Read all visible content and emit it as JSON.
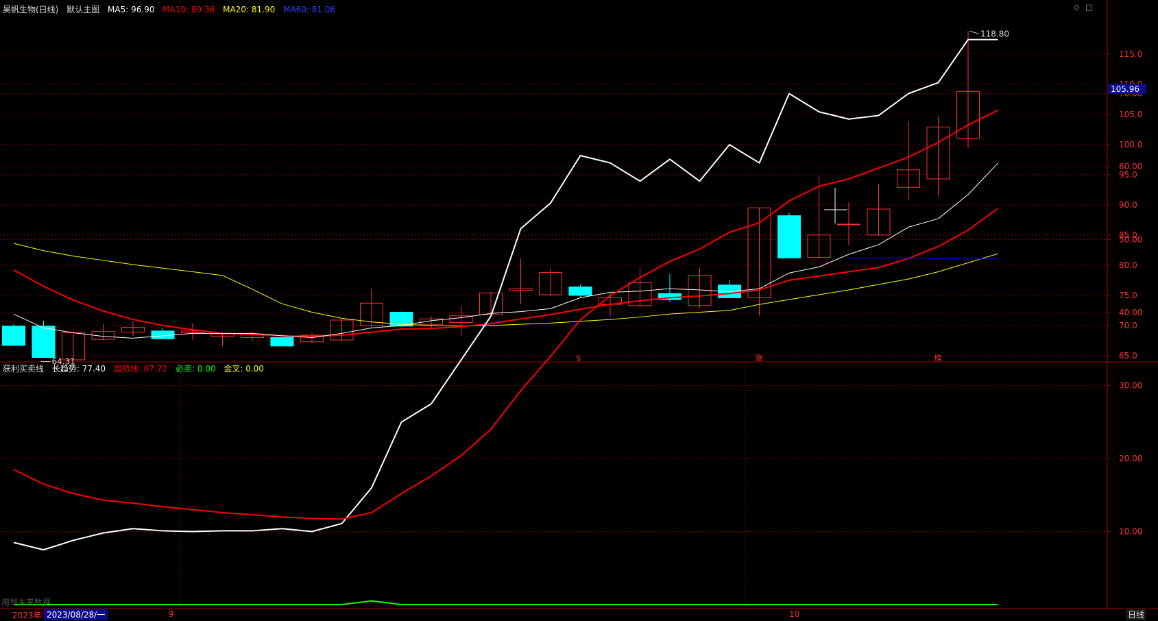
{
  "main_header": {
    "stock": "昊帆生物(日线)",
    "template": "默认主图",
    "ma5": "MA5: 96.90",
    "ma10": "MA10: 89.36",
    "ma20": "MA20: 81.90",
    "ma60": "MA60: 81.06"
  },
  "sub_header": {
    "indicator": "获利买卖线",
    "long_trend": "长趋势: 77.40",
    "trend_line": "趋势线: 67.72",
    "must_sell": "必卖: 0.00",
    "golden_cross": "金叉: 0.00"
  },
  "bottom": {
    "year": "2023年",
    "date": "2023/08/28/一",
    "m9": "9",
    "m10": "10",
    "period": "日线",
    "watermark": "用到未来数据"
  },
  "colors": {
    "up": "#ff3232",
    "down": "#00ffff",
    "ma5": "#ffffff",
    "ma10": "#ff0000",
    "ma20": "#ffff00",
    "ma60": "#0000ff",
    "long": "#ffffff",
    "trend": "#ff0000",
    "must": "#00ff00",
    "grid": "#7a0000"
  },
  "chart_data": [
    {
      "type": "candlestick",
      "yticks": [
        65.0,
        70.0,
        75.0,
        80.0,
        85.0,
        90.0,
        95.0,
        100.0,
        105.0,
        110.0,
        115.0
      ],
      "ylim": [
        63.5,
        120.0
      ],
      "high_label": "118.80",
      "low_label": "64.31",
      "current_label": "105.96",
      "markers": [
        {
          "index": 19,
          "text": "$"
        },
        {
          "index": 25,
          "text": "涨"
        },
        {
          "index": 31,
          "text": "榜"
        }
      ],
      "candles": [
        {
          "o": 69.9,
          "h": 70.2,
          "l": 66.7,
          "c": 66.7
        },
        {
          "o": 69.9,
          "h": 70.8,
          "l": 64.7,
          "c": 64.7
        },
        {
          "o": 64.31,
          "h": 69.0,
          "l": 64.31,
          "c": 68.8
        },
        {
          "o": 67.7,
          "h": 70.3,
          "l": 67.5,
          "c": 69.0
        },
        {
          "o": 68.9,
          "h": 70.7,
          "l": 68.3,
          "c": 69.7
        },
        {
          "o": 69.1,
          "h": 69.6,
          "l": 67.7,
          "c": 67.8
        },
        {
          "o": 68.8,
          "h": 70.4,
          "l": 67.6,
          "c": 69.1
        },
        {
          "o": 68.2,
          "h": 68.7,
          "l": 66.6,
          "c": 68.6
        },
        {
          "o": 68.0,
          "h": 69.0,
          "l": 67.4,
          "c": 68.6
        },
        {
          "o": 68.0,
          "h": 68.1,
          "l": 66.6,
          "c": 66.6
        },
        {
          "o": 67.3,
          "h": 68.8,
          "l": 67.1,
          "c": 68.4
        },
        {
          "o": 67.6,
          "h": 71.0,
          "l": 67.4,
          "c": 70.9
        },
        {
          "o": 70.0,
          "h": 76.2,
          "l": 69.8,
          "c": 73.7
        },
        {
          "o": 72.2,
          "h": 72.3,
          "l": 69.9,
          "c": 69.9
        },
        {
          "o": 70.2,
          "h": 71.5,
          "l": 69.6,
          "c": 71.1
        },
        {
          "o": 70.5,
          "h": 73.2,
          "l": 68.2,
          "c": 71.6
        },
        {
          "o": 71.8,
          "h": 75.6,
          "l": 71.5,
          "c": 75.4
        },
        {
          "o": 75.8,
          "h": 81.0,
          "l": 73.5,
          "c": 76.1
        },
        {
          "o": 75.1,
          "h": 79.5,
          "l": 74.9,
          "c": 78.8
        },
        {
          "o": 76.4,
          "h": 76.8,
          "l": 74.7,
          "c": 75.0
        },
        {
          "o": 73.5,
          "h": 75.3,
          "l": 71.5,
          "c": 74.6
        },
        {
          "o": 73.3,
          "h": 79.7,
          "l": 73.1,
          "c": 77.1
        },
        {
          "o": 75.3,
          "h": 78.5,
          "l": 73.9,
          "c": 74.3
        },
        {
          "o": 73.3,
          "h": 79.6,
          "l": 72.9,
          "c": 78.3
        },
        {
          "o": 76.7,
          "h": 77.5,
          "l": 74.6,
          "c": 74.6
        },
        {
          "o": 74.6,
          "h": 89.5,
          "l": 71.6,
          "c": 89.5
        },
        {
          "o": 88.2,
          "h": 88.7,
          "l": 81.2,
          "c": 81.2
        },
        {
          "o": 81.3,
          "h": 94.7,
          "l": 81.0,
          "c": 85.0
        },
        {
          "o": 86.8,
          "h": 90.4,
          "l": 83.3,
          "c": 86.8
        },
        {
          "o": 85.0,
          "h": 93.4,
          "l": 84.9,
          "c": 89.3
        },
        {
          "o": 92.9,
          "h": 103.8,
          "l": 90.8,
          "c": 95.8
        },
        {
          "o": 94.3,
          "h": 104.7,
          "l": 91.4,
          "c": 102.9
        },
        {
          "o": 101.0,
          "h": 118.8,
          "l": 99.4,
          "c": 108.8
        }
      ],
      "ma5": [
        71.9,
        69.6,
        68.8,
        68.2,
        67.9,
        68.3,
        68.7,
        68.7,
        68.7,
        68.3,
        68.0,
        68.7,
        69.6,
        70.0,
        70.8,
        71.3,
        72.0,
        72.3,
        72.8,
        74.6,
        75.5,
        75.7,
        76.1,
        75.9,
        75.6,
        76.1,
        78.7,
        79.7,
        81.8,
        83.4,
        86.3,
        87.7,
        91.7,
        96.9
      ],
      "ma10": [
        79.2,
        76.5,
        74.2,
        72.4,
        71.0,
        70.0,
        69.3,
        68.7,
        68.5,
        68.3,
        68.2,
        68.4,
        68.9,
        69.4,
        69.5,
        69.8,
        70.3,
        71.1,
        71.8,
        72.7,
        73.5,
        74.1,
        74.6,
        74.9,
        75.3,
        75.9,
        77.5,
        78.2,
        78.9,
        79.6,
        81.1,
        83.1,
        85.8,
        89.4
      ],
      "ma20": [
        83.6,
        82.4,
        81.5,
        80.8,
        80.1,
        79.5,
        78.9,
        78.3,
        76.0,
        73.6,
        72.2,
        71.2,
        70.6,
        70.2,
        70.0,
        69.9,
        70.0,
        70.2,
        70.4,
        70.7,
        71.0,
        71.4,
        71.9,
        72.2,
        72.5,
        73.5,
        74.3,
        75.1,
        75.9,
        76.8,
        77.7,
        78.9,
        80.4,
        81.9
      ],
      "ma60": [
        81.2,
        81.2,
        81.2,
        81.1,
        81.0,
        81.06
      ]
    },
    {
      "type": "line",
      "title": "获利买卖线",
      "yticks": [
        10.0,
        20.0,
        30.0,
        40.0,
        50.0,
        60.0,
        70.0
      ],
      "ylim": [
        0,
        79
      ],
      "series": [
        {
          "name": "长趋势",
          "values": [
            8.5,
            7.5,
            8.8,
            9.8,
            10.4,
            10.1,
            10.0,
            10.1,
            10.1,
            10.4,
            10.0,
            11.1,
            16.0,
            25.0,
            27.5,
            33.5,
            39.5,
            51.5,
            55.0,
            61.5,
            60.5,
            58.0,
            61.0,
            58.0,
            63.0,
            60.5,
            70.0,
            67.5,
            66.5,
            67.0,
            70.0,
            71.5,
            77.4,
            77.4
          ]
        },
        {
          "name": "趋势线",
          "values": [
            18.5,
            16.5,
            15.2,
            14.3,
            13.9,
            13.4,
            13.0,
            12.6,
            12.3,
            12.0,
            11.8,
            11.7,
            12.6,
            15.2,
            17.6,
            20.4,
            24.0,
            29.3,
            34.0,
            39.0,
            42.3,
            44.8,
            47.0,
            48.7,
            51.0,
            52.3,
            55.3,
            57.3,
            58.3,
            59.8,
            61.3,
            63.3,
            65.7,
            67.72
          ]
        },
        {
          "name": "必卖",
          "values": [
            0.0,
            0.0,
            0.0,
            0.0,
            0.0,
            0.0,
            0.0,
            0.0,
            0.0,
            0.0,
            0.0,
            0.0,
            0.5,
            0.0,
            0.0,
            0.0,
            0.0,
            0.0,
            0.0,
            0.0,
            0.0,
            0.0,
            0.0,
            0.0,
            0.0,
            0.0,
            0.0,
            0.0,
            0.0,
            0.0,
            0.0,
            0.0,
            0.0,
            0.0
          ]
        }
      ]
    }
  ]
}
